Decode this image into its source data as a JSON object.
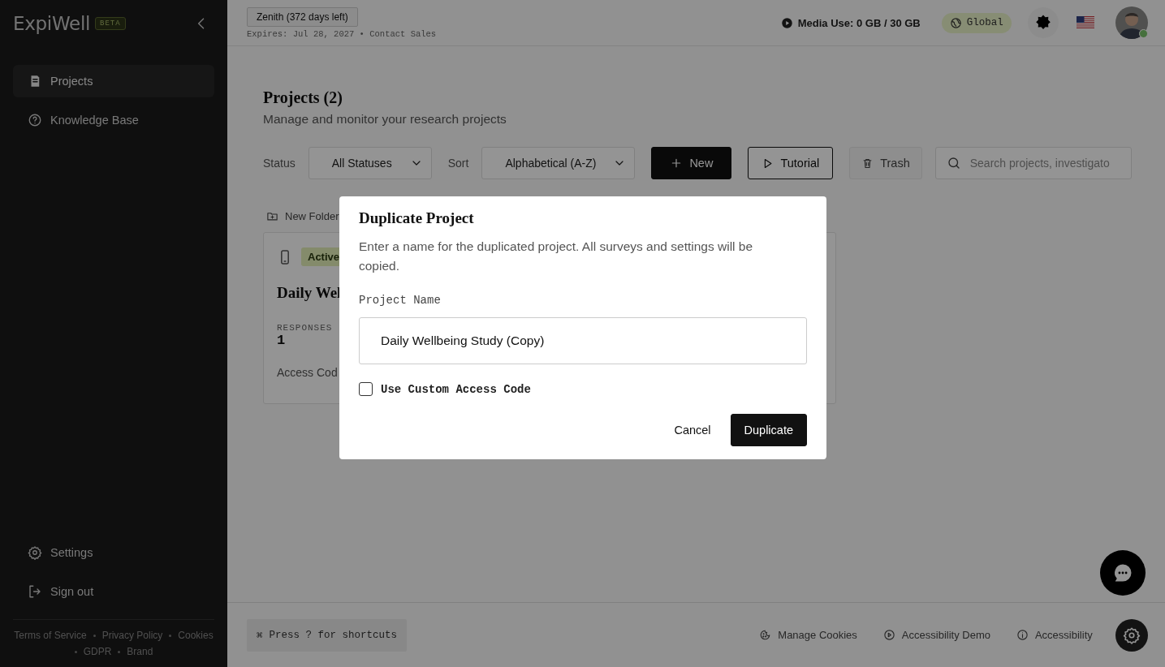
{
  "sidebar": {
    "logo": "ExpiWell",
    "badge": "BETA",
    "nav": [
      {
        "label": "Projects",
        "selected": true
      },
      {
        "label": "Knowledge Base",
        "selected": false
      }
    ],
    "bottom": [
      {
        "label": "Settings",
        "kind": "settings"
      },
      {
        "label": "Sign out",
        "kind": "signout"
      }
    ],
    "links": [
      "Terms of Service",
      "Privacy Policy",
      "Cookies",
      "GDPR",
      "Brand"
    ]
  },
  "topbar": {
    "plan": "Zenith (372 days left)",
    "expires": "Expires: Jul 28, 2027 • Contact Sales",
    "media": "Media Use: 0 GB / 30 GB",
    "region": "Global"
  },
  "page": {
    "title": "Projects (2)",
    "subtitle": "Manage and monitor your research projects",
    "filters": [
      {
        "label": "Status",
        "value": "All Statuses"
      },
      {
        "label": "Sort",
        "value": "Alphabetical (A-Z)"
      }
    ],
    "buttons": [
      {
        "label": "New",
        "kind": "primary"
      },
      {
        "label": "Tutorial",
        "kind": "outline"
      },
      {
        "label": "Trash",
        "kind": "ghost"
      }
    ],
    "search": {
      "placeholder": "Search projects, investigato"
    },
    "new_folder": "New Folder",
    "card": {
      "status": "Active",
      "title": "Daily Wel",
      "stat_label": "RESPONSES",
      "stat_value": "1",
      "access": "Access Cod"
    }
  },
  "dialog": {
    "title": "Duplicate Project",
    "description": "Enter a name for the duplicated project. All surveys and settings will be copied.",
    "field_label": "Project Name",
    "field_value": "Daily Wellbeing Study (Copy)",
    "checkbox": {
      "label": "Use Custom Access Code",
      "checked": false
    },
    "buttons": [
      {
        "label": "Cancel",
        "kind": "ghost"
      },
      {
        "label": "Duplicate",
        "kind": "primary"
      }
    ]
  },
  "footer": {
    "shortcut_key": "⌘",
    "shortcut": "Press ? for shortcuts",
    "links": [
      {
        "label": "Manage Cookies",
        "kind": "cookie"
      },
      {
        "label": "Accessibility Demo",
        "kind": "play"
      },
      {
        "label": "Accessibility",
        "kind": "info"
      }
    ]
  }
}
